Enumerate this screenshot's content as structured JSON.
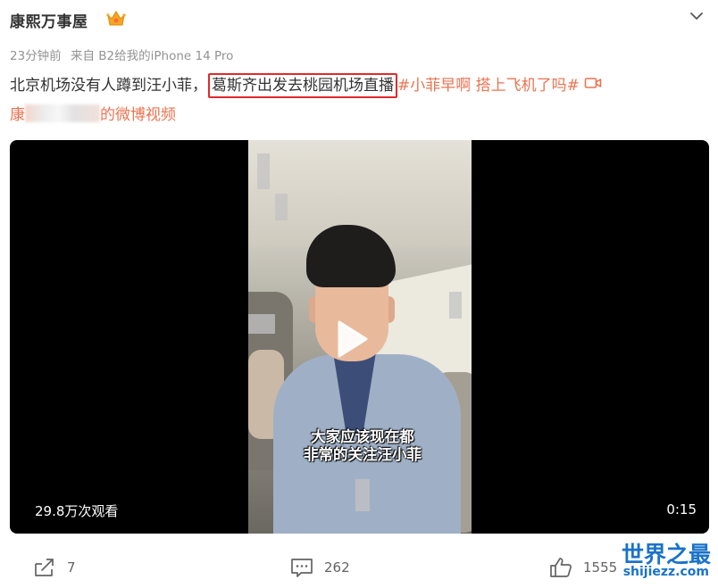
{
  "post": {
    "author": "康熙万事屋",
    "time": "23分钟前",
    "source": "来自 B2给我的iPhone 14 Pro",
    "text_plain": "北京机场没有人蹲到汪小菲，",
    "text_highlight": "葛斯齐出发去桃园机场直播",
    "topic": "#小菲早啊 搭上飞机了吗#",
    "video_link_suffix": "的微博视频",
    "video_link_prefix": "康"
  },
  "video": {
    "subtitle_line1": "大家应该现在都",
    "subtitle_line2": "非常的关注汪小菲",
    "views": "29.8万次观看",
    "duration": "0:15"
  },
  "actions": {
    "repost_count": "7",
    "comment_count": "262",
    "like_count": "1555"
  },
  "watermark": {
    "title": "世界之最",
    "url": "shijiezz.com"
  },
  "colors": {
    "accent_link": "#eb7350",
    "highlight_box": "#e02a2a",
    "watermark": "#1a73c9"
  },
  "icons": [
    "crown-icon",
    "chevron-down-icon",
    "video-camera-icon",
    "play-icon",
    "repost-icon",
    "comment-icon",
    "like-icon"
  ]
}
